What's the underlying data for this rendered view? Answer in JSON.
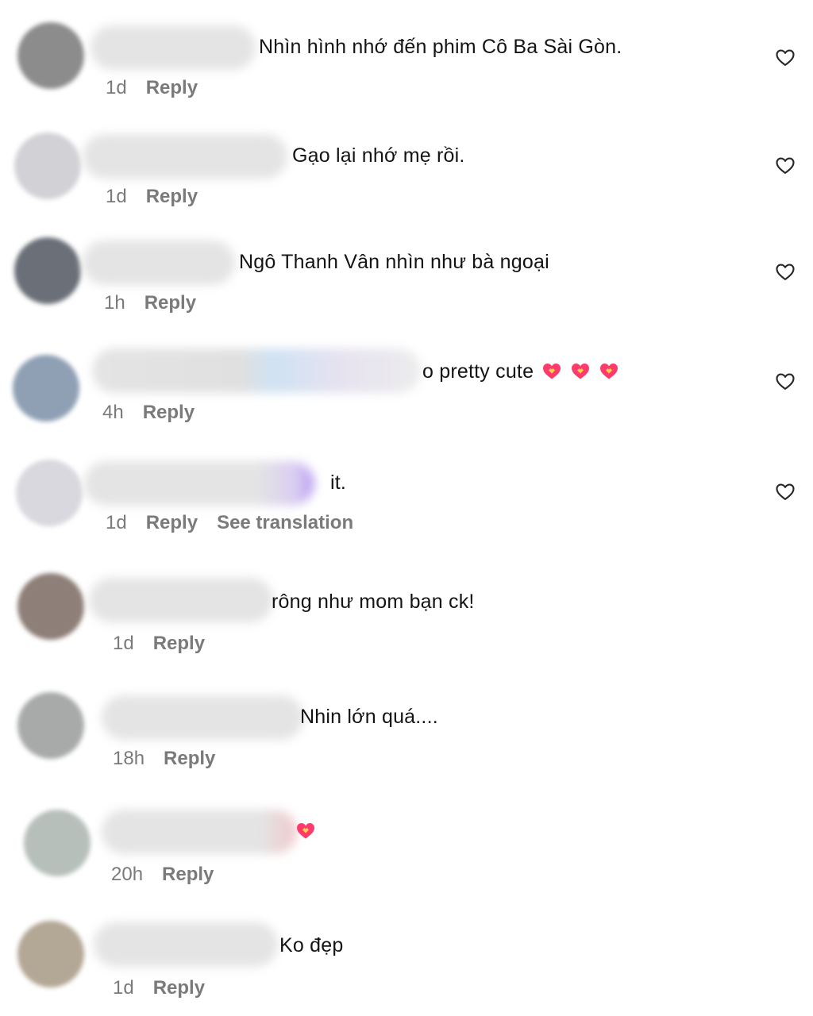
{
  "comments": [
    {
      "text": "Nhìn hình nhớ đến phim Cô Ba Sài Gòn.",
      "time": "1d",
      "reply": "Reply",
      "liked": false,
      "heart_emojis": 0,
      "avatar_color": "#8c8c8c"
    },
    {
      "text": "Gạo lại nhớ mẹ rồi.",
      "time": "1d",
      "reply": "Reply",
      "liked": false,
      "heart_emojis": 0,
      "avatar_color": "#d2d2d6"
    },
    {
      "text": "Ngô Thanh Vân nhìn như bà ngoại",
      "time": "1h",
      "reply": "Reply",
      "liked": false,
      "heart_emojis": 0,
      "avatar_color": "#6a6f78"
    },
    {
      "text": "o pretty cute",
      "time": "4h",
      "reply": "Reply",
      "liked": false,
      "heart_emojis": 3,
      "avatar_color": "#8fa0b4"
    },
    {
      "text": "it.",
      "time": "1d",
      "reply": "Reply",
      "see_translation": "See translation",
      "liked": false,
      "heart_emojis": 0,
      "avatar_color": "#d8d8de"
    },
    {
      "text": "rông như mom bạn ck!",
      "time": "1d",
      "reply": "Reply",
      "heart_emojis": 0,
      "avatar_color": "#8e7f78"
    },
    {
      "text": "Nhin lớn quá....",
      "time": "18h",
      "reply": "Reply",
      "heart_emojis": 0,
      "avatar_color": "#a7aaa9"
    },
    {
      "text": "",
      "time": "20h",
      "reply": "Reply",
      "heart_emojis": 1,
      "avatar_color": "#b6bfba"
    },
    {
      "text": "Ko đẹp",
      "time": "1d",
      "reply": "Reply",
      "heart_emojis": 0,
      "avatar_color": "#b3a795"
    }
  ],
  "colors": {
    "text": "#141414",
    "meta": "#7a7a7a",
    "heart_emoji": "#ff3b6b"
  },
  "icons": {
    "like": "heart-outline-icon",
    "emoji": "heart-emoji-icon"
  }
}
